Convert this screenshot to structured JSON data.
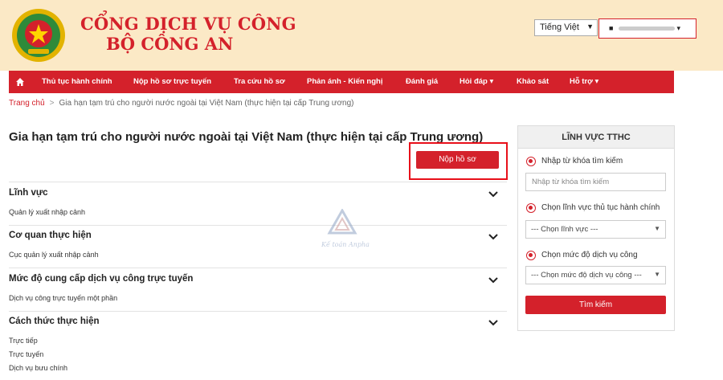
{
  "header": {
    "brand_line1": "CỔNG DỊCH VỤ CÔNG",
    "brand_line2": "BỘ CÔNG AN",
    "language": "Tiếng Việt",
    "colors": {
      "primary": "#d4212b",
      "header_bg": "#fbe9c6"
    }
  },
  "nav": {
    "home_icon": "home-icon",
    "items": [
      "Thủ tục hành chính",
      "Nộp hồ sơ trực tuyến",
      "Tra cứu hồ sơ",
      "Phản ánh - Kiến nghị",
      "Đánh giá",
      "Hỏi đáp ▾",
      "Khảo sát",
      "Hỗ trợ ▾"
    ]
  },
  "breadcrumb": {
    "home": "Trang chủ",
    "separator": ">",
    "current": "Gia hạn tạm trú cho người nước ngoài tại Việt Nam (thực hiện tại cấp Trung ương)"
  },
  "main": {
    "title": "Gia hạn tạm trú cho người nước ngoài tại Việt Nam (thực hiện tại cấp Trung ương)",
    "submit_label": "Nộp hồ sơ",
    "sections": [
      {
        "heading": "Lĩnh vực",
        "values": [
          "Quản lý xuất nhập cảnh"
        ]
      },
      {
        "heading": "Cơ quan thực hiện",
        "values": [
          "Cục quản lý xuất nhập cảnh"
        ]
      },
      {
        "heading": "Mức độ cung cấp dịch vụ công trực tuyến",
        "values": [
          "Dịch vụ công trực tuyến một phần"
        ]
      },
      {
        "heading": "Cách thức thực hiện",
        "values": [
          "Trực tiếp",
          "Trực tuyến",
          "Dịch vụ bưu chính"
        ]
      }
    ]
  },
  "sidebar": {
    "title": "LĨNH VỰC TTHC",
    "option_keyword": "Nhập từ khóa tìm kiếm",
    "keyword_placeholder": "Nhập từ khóa tìm kiếm",
    "option_field": "Chọn lĩnh vực thủ tục hành chính",
    "field_select": "--- Chọn lĩnh vực ---",
    "option_level": "Chọn mức độ dịch vụ công",
    "level_select": "--- Chọn mức độ dịch vụ công ---",
    "search_label": "Tìm kiếm"
  },
  "watermark": {
    "text": "Kế toán Anpha"
  }
}
